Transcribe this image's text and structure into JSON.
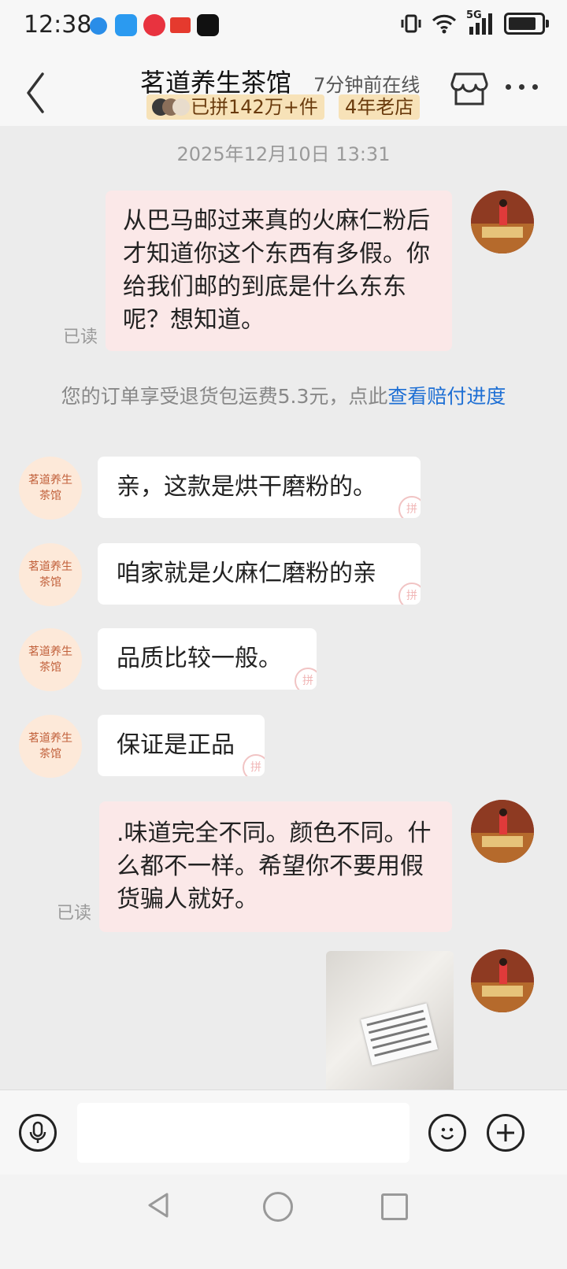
{
  "status_bar": {
    "time": "12:38",
    "network": "5G"
  },
  "header": {
    "shop_name": "茗道养生茶馆",
    "online_status": "7分钟前在线",
    "badge_sold": "已拼142万+件",
    "badge_age": "4年老店"
  },
  "chat": {
    "timestamp": "2025年12月10日 13:31",
    "shop_avatar_text": "茗道养生茶馆",
    "read_label": "已读",
    "messages": [
      {
        "from": "me",
        "text": "从巴马邮过来真的火麻仁粉后才知道你这个东西有多假。你给我们邮的到底是什么东东呢？想知道。"
      },
      {
        "from": "shop",
        "text": "亲，这款是烘干磨粉的。"
      },
      {
        "from": "shop",
        "text": "咱家就是火麻仁磨粉的亲"
      },
      {
        "from": "shop",
        "text": "品质比较一般。"
      },
      {
        "from": "shop",
        "text": "保证是正品"
      },
      {
        "from": "me",
        "text": ".味道完全不同。颜色不同。什么都不一样。希望你不要用假货骗人就好。"
      }
    ],
    "notice": {
      "text": "您的订单享受退货包运费5.3元，点此",
      "link": "查看赔付进度"
    },
    "pin_glyph": "拼"
  },
  "colors": {
    "accent_link": "#1e6fd4",
    "my_bubble": "#fbe8e8",
    "badge_bg": "#f7e2b8"
  }
}
